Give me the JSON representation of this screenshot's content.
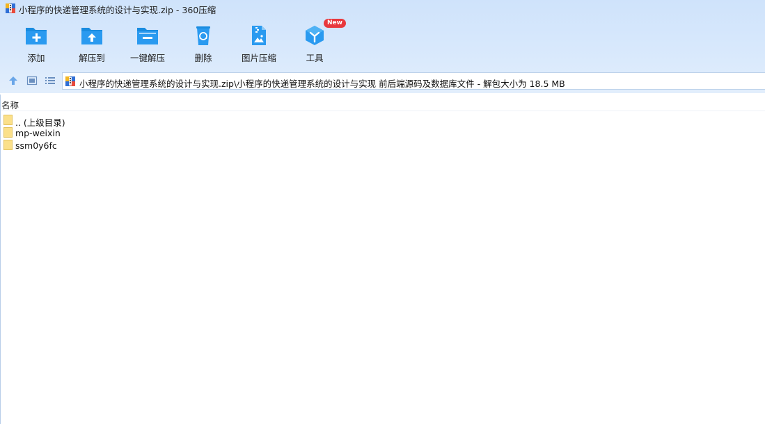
{
  "window": {
    "title": "小程序的快递管理系统的设计与实现.zip - 360压缩"
  },
  "toolbar": {
    "items": [
      {
        "label": "添加",
        "icon": "add-icon"
      },
      {
        "label": "解压到",
        "icon": "extract-to-icon"
      },
      {
        "label": "一键解压",
        "icon": "one-click-extract-icon"
      },
      {
        "label": "删除",
        "icon": "delete-icon"
      },
      {
        "label": "图片压缩",
        "icon": "image-compress-icon"
      },
      {
        "label": "工具",
        "icon": "tools-icon",
        "badge": "New"
      }
    ],
    "accent": "#1a8ce0",
    "badge_color": "#e8383d"
  },
  "nav": {
    "address": "小程序的快递管理系统的设计与实现.zip\\小程序的快递管理系统的设计与实现 前后端源码及数据库文件 - 解包大小为 18.5 MB"
  },
  "list": {
    "header_name": "名称",
    "rows": [
      {
        "label": ".. (上级目录)"
      },
      {
        "label": "mp-weixin"
      },
      {
        "label": "ssm0y6fc"
      }
    ]
  }
}
